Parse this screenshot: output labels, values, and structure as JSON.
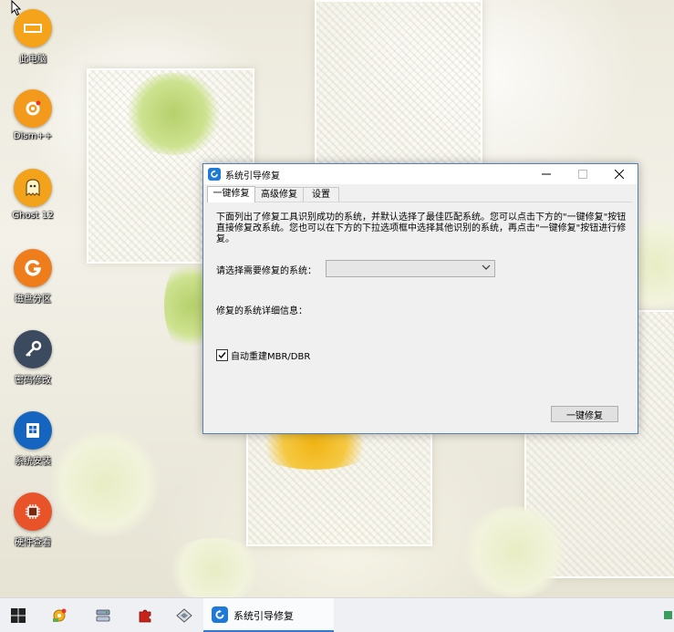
{
  "desktop": {
    "icons": [
      {
        "label": "此电脑",
        "icon": "computer-icon",
        "color": "#f5a31a"
      },
      {
        "label": "Dism++",
        "icon": "gear-icon",
        "color": "#f39a1d"
      },
      {
        "label": "Ghost 12",
        "icon": "ghost-icon",
        "color": "#f2a21b"
      },
      {
        "label": "磁盘分区",
        "icon": "partition-icon",
        "color": "#f07d1c"
      },
      {
        "label": "密码修改",
        "icon": "key-icon",
        "color": "#3b4a5e"
      },
      {
        "label": "系统安装",
        "icon": "install-icon",
        "color": "#1565c0"
      },
      {
        "label": "硬件查看",
        "icon": "chip-icon",
        "color": "#e9532a"
      }
    ]
  },
  "dialog": {
    "title": "系统引导修复",
    "tabs": [
      "一键修复",
      "高级修复",
      "设置"
    ],
    "active_tab": 0,
    "description": "下面列出了修复工具识别成功的系统，并默认选择了最佳匹配系统。您可以点击下方的\"一键修复\"按钮直接修复改系统。您也可以在下方的下拉选项框中选择其他识别的系统，再点击\"一键修复\"按钮进行修复。",
    "select_label": "请选择需要修复的系统：",
    "select_value": "",
    "detail_label": "修复的系统详细信息：",
    "checkbox_label": "自动重建MBR/DBR",
    "checkbox_checked": true,
    "repair_button": "一键修复"
  },
  "taskbar": {
    "active_app_label": "系统引导修复",
    "items": [
      "windows-start-icon",
      "dism-tray-icon",
      "disk-tool-icon",
      "puzzle-tool-icon",
      "drive-tool-icon"
    ],
    "accent": "#2e7bd6"
  }
}
